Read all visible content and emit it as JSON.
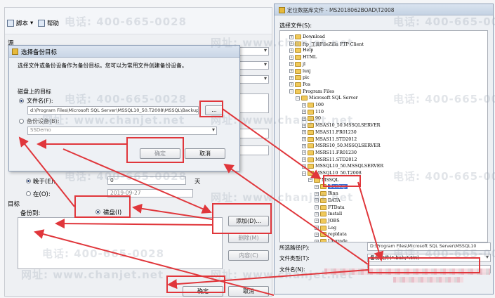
{
  "main": {
    "toolbar": {
      "script": "脚本",
      "help": "帮助"
    },
    "labels": {
      "source": "源",
      "target": "目标",
      "backup_to": "备份到:",
      "after": "晚于(E):",
      "on": "在(O):"
    },
    "fields": {
      "days_value": "0",
      "days_unit": "天",
      "date_value": "2019-09-27"
    },
    "radio_disk": "磁盘(I)",
    "buttons": {
      "add": "添加(D)...",
      "remove": "删除(M)",
      "content": "内容(C)",
      "ok": "确定",
      "cancel": "取消"
    }
  },
  "select_dialog": {
    "title": "选择备份目标",
    "description": "选择文件或备份设备作为备份目标。您可以为常用文件创建备份设备。",
    "section": "磁盘上的目标",
    "filename_label": "文件名(F):",
    "filename_value": "d:\\Program Files\\Microsoft SQL Server\\MSSQL10_50.T2008\\MSSQL\\Backup\\",
    "browse_label": "...",
    "device_label": "备份设备(B):",
    "device_value": "SSDemo",
    "ok": "确定",
    "cancel": "取消"
  },
  "folder_dialog": {
    "title": "定位数据库文件 - MS2018062BOAD\\T2008",
    "select_label": "选择文件(S):",
    "tree": [
      "Download",
      "ftp_工具FileZilla FTP Client",
      "Help",
      "HTML",
      "jl",
      "luxj",
      "pic",
      "Pos",
      "Program Files",
      "Microsoft SQL Server",
      "100",
      "110",
      "90",
      "MSAS10_50.MSSQLSERVER",
      "MSAS11.FR01230",
      "MSAS11.STD2012",
      "MSRS10_50.MSSQLSERVER",
      "MSRS11.FR01230",
      "MSRS11.STD2012",
      "MSSQL10_50.MSSQLSERVER",
      "MSSQL10_50.T2008",
      "MSSQL",
      "Backup",
      "Binn",
      "DATA",
      "FTData",
      "Install",
      "JOBS",
      "Log",
      "repldata",
      "Upgrade"
    ],
    "path_label": "所选路径(P):",
    "path_value": "D:\\Program Files\\Microsoft SQL Server\\MSSQL10",
    "type_label": "文件类型(T):",
    "type_value": "备份文件(*.bak;*.trn)",
    "name_label": "文件名(N):"
  },
  "watermark": {
    "phone": "电话: 400-665-0028",
    "site": "网址: www.chanjet.net"
  },
  "colors": {
    "annotation_red": "#e0363b",
    "selection_blue": "#3c6fd1",
    "folder_yellow": "#f0c95a"
  }
}
